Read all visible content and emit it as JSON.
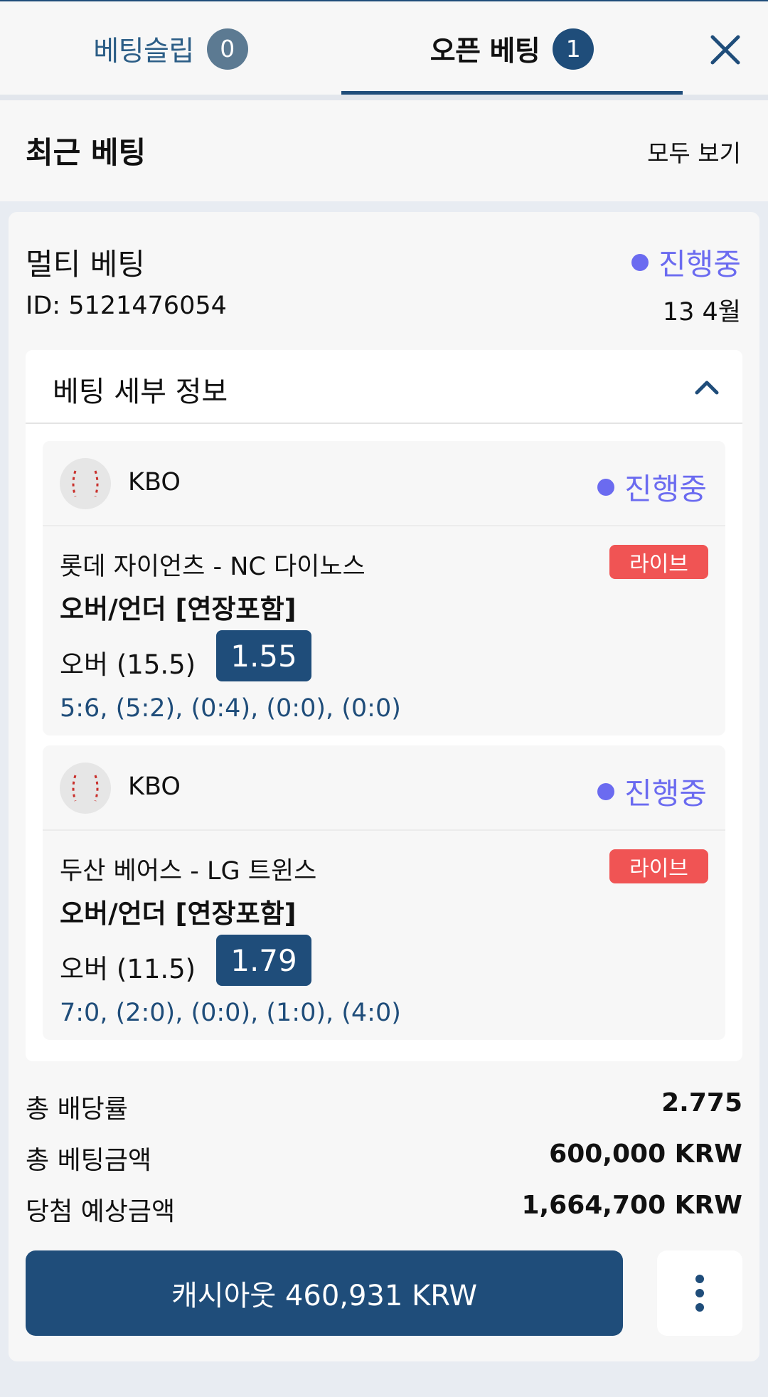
{
  "tabs": {
    "slip": {
      "label": "베팅슬립",
      "count": "0"
    },
    "open": {
      "label": "오픈 베팅",
      "count": "1"
    }
  },
  "recent": {
    "title": "최근 베팅",
    "view_all": "모두 보기"
  },
  "bet": {
    "type": "멀티 베팅",
    "status": "진행중",
    "id": "ID: 5121476054",
    "date": "13 4월",
    "details_title": "베팅 세부 정보",
    "selections": [
      {
        "league": "KBO",
        "status": "진행중",
        "match": "롯데 자이언츠 - NC 다이노스",
        "live": "라이브",
        "market": "오버/언더 [연장포함]",
        "pick": "오버 (15.5)",
        "odds": "1.55",
        "score": "5:6, (5:2), (0:4), (0:0), (0:0)"
      },
      {
        "league": "KBO",
        "status": "진행중",
        "match": "두산 베어스 - LG 트윈스",
        "live": "라이브",
        "market": "오버/언더 [연장포함]",
        "pick": "오버 (11.5)",
        "odds": "1.79",
        "score": "7:0, (2:0), (0:0), (1:0), (4:0)"
      }
    ],
    "summary": {
      "total_odds_label": "총 배당률",
      "total_odds": "2.775",
      "stake_label": "총 베팅금액",
      "stake": "600,000 KRW",
      "potential_label": "당첨 예상금액",
      "potential": "1,664,700 KRW"
    },
    "cashout_label": "캐시아웃 460,931 KRW"
  },
  "colors": {
    "brand": "#1f4d7a",
    "status": "#6b6bf0",
    "live": "#f05454"
  }
}
